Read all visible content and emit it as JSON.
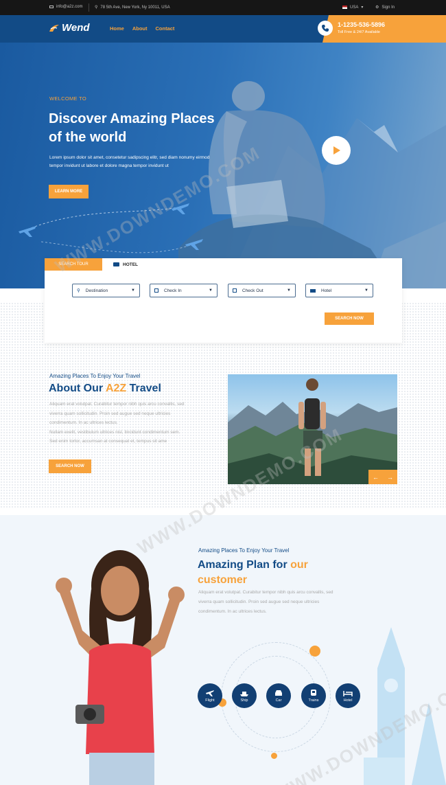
{
  "topbar": {
    "email": "info@a2z.com",
    "address": "78 5th Ave, New York, Ny 10011, USA",
    "language": "USA",
    "signin": "Sign In"
  },
  "header": {
    "logo": "Wend",
    "nav": [
      "Home",
      "About",
      "Contact"
    ],
    "phone": "1-1235-536-5896",
    "phone_sub": "Toll Free & 24/7 Available"
  },
  "hero": {
    "welcome": "WELCOME TO",
    "title_line1": "Discover Amazing Places",
    "title_line2": "of the world",
    "desc_line1": "Lorem ipsum dolor sit amet, consetetur sadipscing elitr, sed diam nonumy eirmod",
    "desc_line2": "tempor invidunt ut labore et dolore magna tempor invidunt ut",
    "cta": "LEARN MORE"
  },
  "search": {
    "tab_active": "SEARCH TOUR",
    "tab_hotel": "HOTEL",
    "fields": [
      "Destination",
      "Check In",
      "Check Out",
      "Hotel"
    ],
    "button": "SEARCH NOW"
  },
  "about": {
    "kicker": "Amazing Places To Enjoy Your Travel",
    "title_a": "About Our ",
    "title_hl": "A2Z",
    "title_b": " Travel",
    "text_lines": [
      "Aliquam erat volutpat. Curabitur tempor nibh quis arcu convallis, sed",
      "viverra quam sollicitudin. Proin sed augue sed neque ultricies",
      "condimentum. In ac ultrices lectus.",
      "Nullam exelit, vestibulum ultrices nisl, tincidunt condimentum sem.",
      "Sed enim tortor, accumsan at consequat et, tempus sit ame"
    ],
    "button": "SEARCH NOW"
  },
  "plan": {
    "kicker": "Amazing Places To Enjoy Your Travel",
    "title_a": "Amazing Plan for ",
    "title_hl": "our customer",
    "text_lines": [
      "Aliquam erat volutpat. Curabitur tempor nibh quis arcu convallis, sed",
      "viverra quam sollicitudin. Proin sed augue sed neque ultricies",
      "condimentum. In ac ultrices lectus."
    ],
    "services": [
      "Flight",
      "Ship",
      "Car",
      "Trains",
      "Hotel"
    ]
  },
  "watermark": "WWW.DOWNDEMO.COM"
}
